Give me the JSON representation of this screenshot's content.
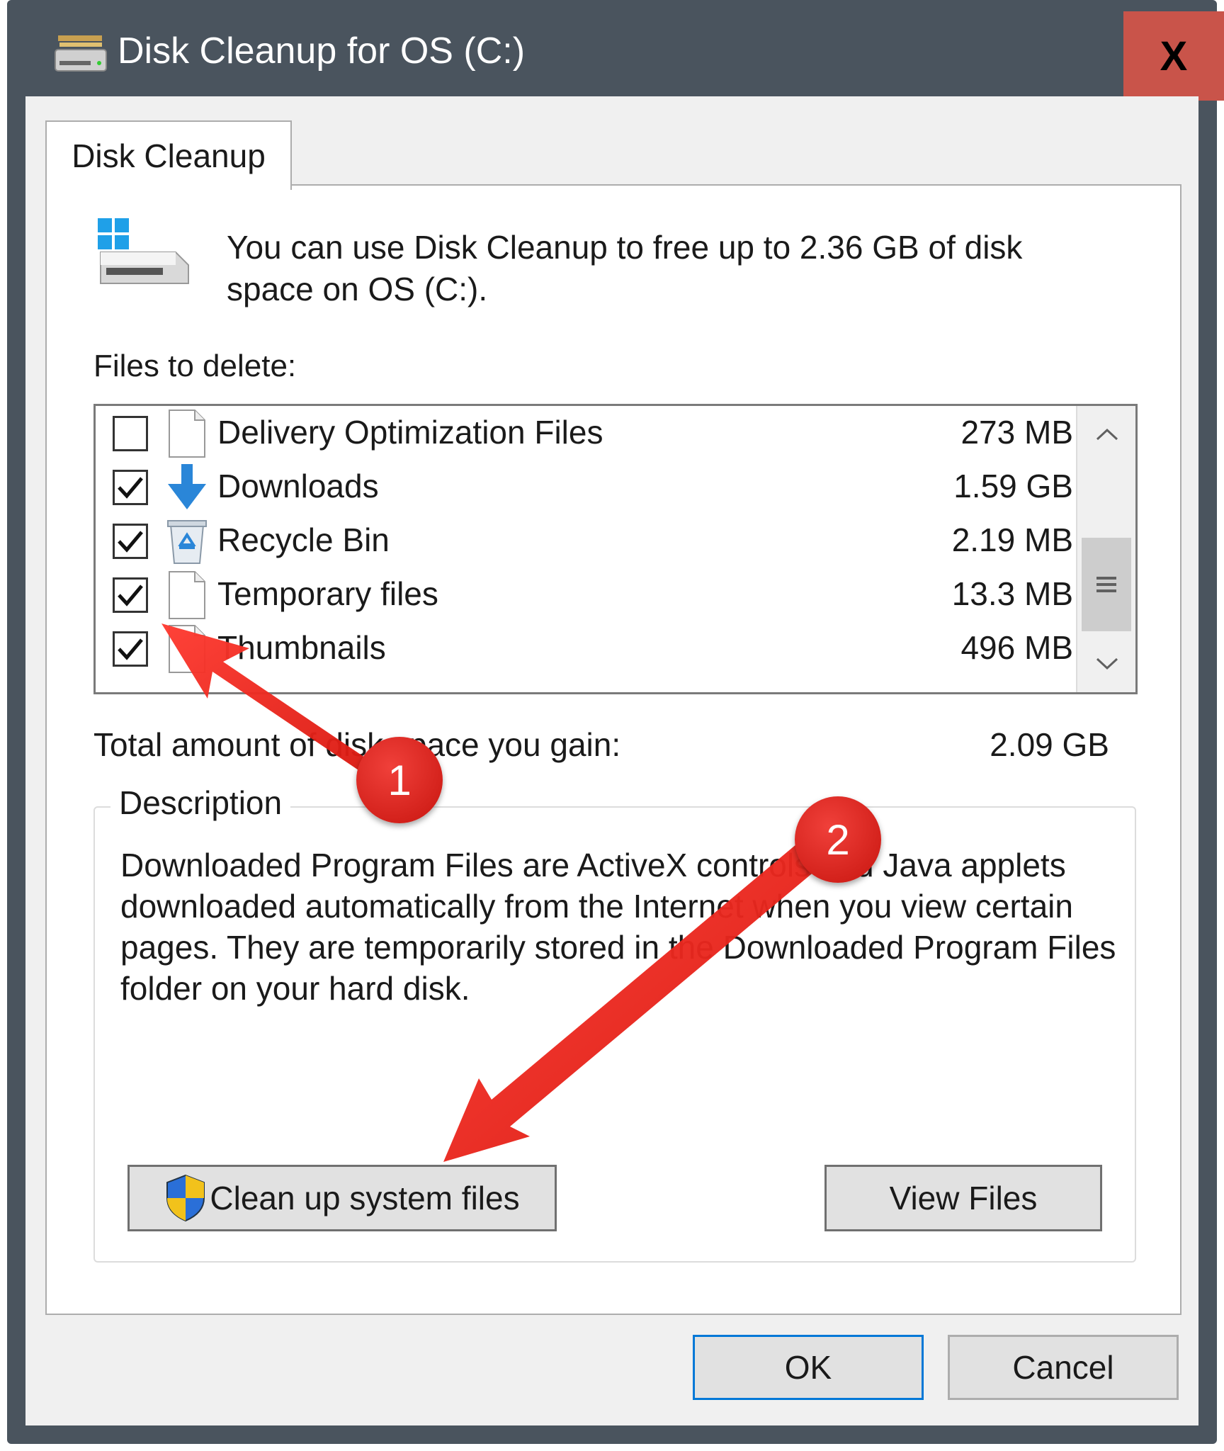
{
  "window": {
    "title": "Disk Cleanup for OS (C:)",
    "close_glyph": "X",
    "title_icon": "disk-cleanup-icon"
  },
  "tab": {
    "label": "Disk Cleanup"
  },
  "intro": {
    "text": "You can use Disk Cleanup to free up to 2.36 GB of disk space on OS (C:)."
  },
  "files": {
    "label": "Files to delete:",
    "items": [
      {
        "name": "Delivery Optimization Files",
        "size": "273 MB",
        "checked": false,
        "icon": "file-icon"
      },
      {
        "name": "Downloads",
        "size": "1.59 GB",
        "checked": true,
        "icon": "download-arrow-icon"
      },
      {
        "name": "Recycle Bin",
        "size": "2.19 MB",
        "checked": true,
        "icon": "recycle-bin-icon"
      },
      {
        "name": "Temporary files",
        "size": "13.3 MB",
        "checked": true,
        "icon": "file-icon"
      },
      {
        "name": "Thumbnails",
        "size": "496 MB",
        "checked": true,
        "icon": "file-icon"
      }
    ]
  },
  "total": {
    "label": "Total amount of disk space you gain:",
    "value": "2.09 GB"
  },
  "description": {
    "legend": "Description",
    "text": "Downloaded Program Files are ActiveX controls and Java applets downloaded automatically from the Internet when you view certain pages. They are temporarily stored in the Downloaded Program Files folder on your hard disk."
  },
  "buttons": {
    "cleanup": "Clean up system files",
    "view_files": "View Files",
    "ok": "OK",
    "cancel": "Cancel"
  },
  "annotations": {
    "badge1": "1",
    "badge2": "2",
    "color": "#e8211a"
  },
  "colors": {
    "titlebar": "#4a545e",
    "close": "#c9544a",
    "accent": "#0078d7"
  }
}
